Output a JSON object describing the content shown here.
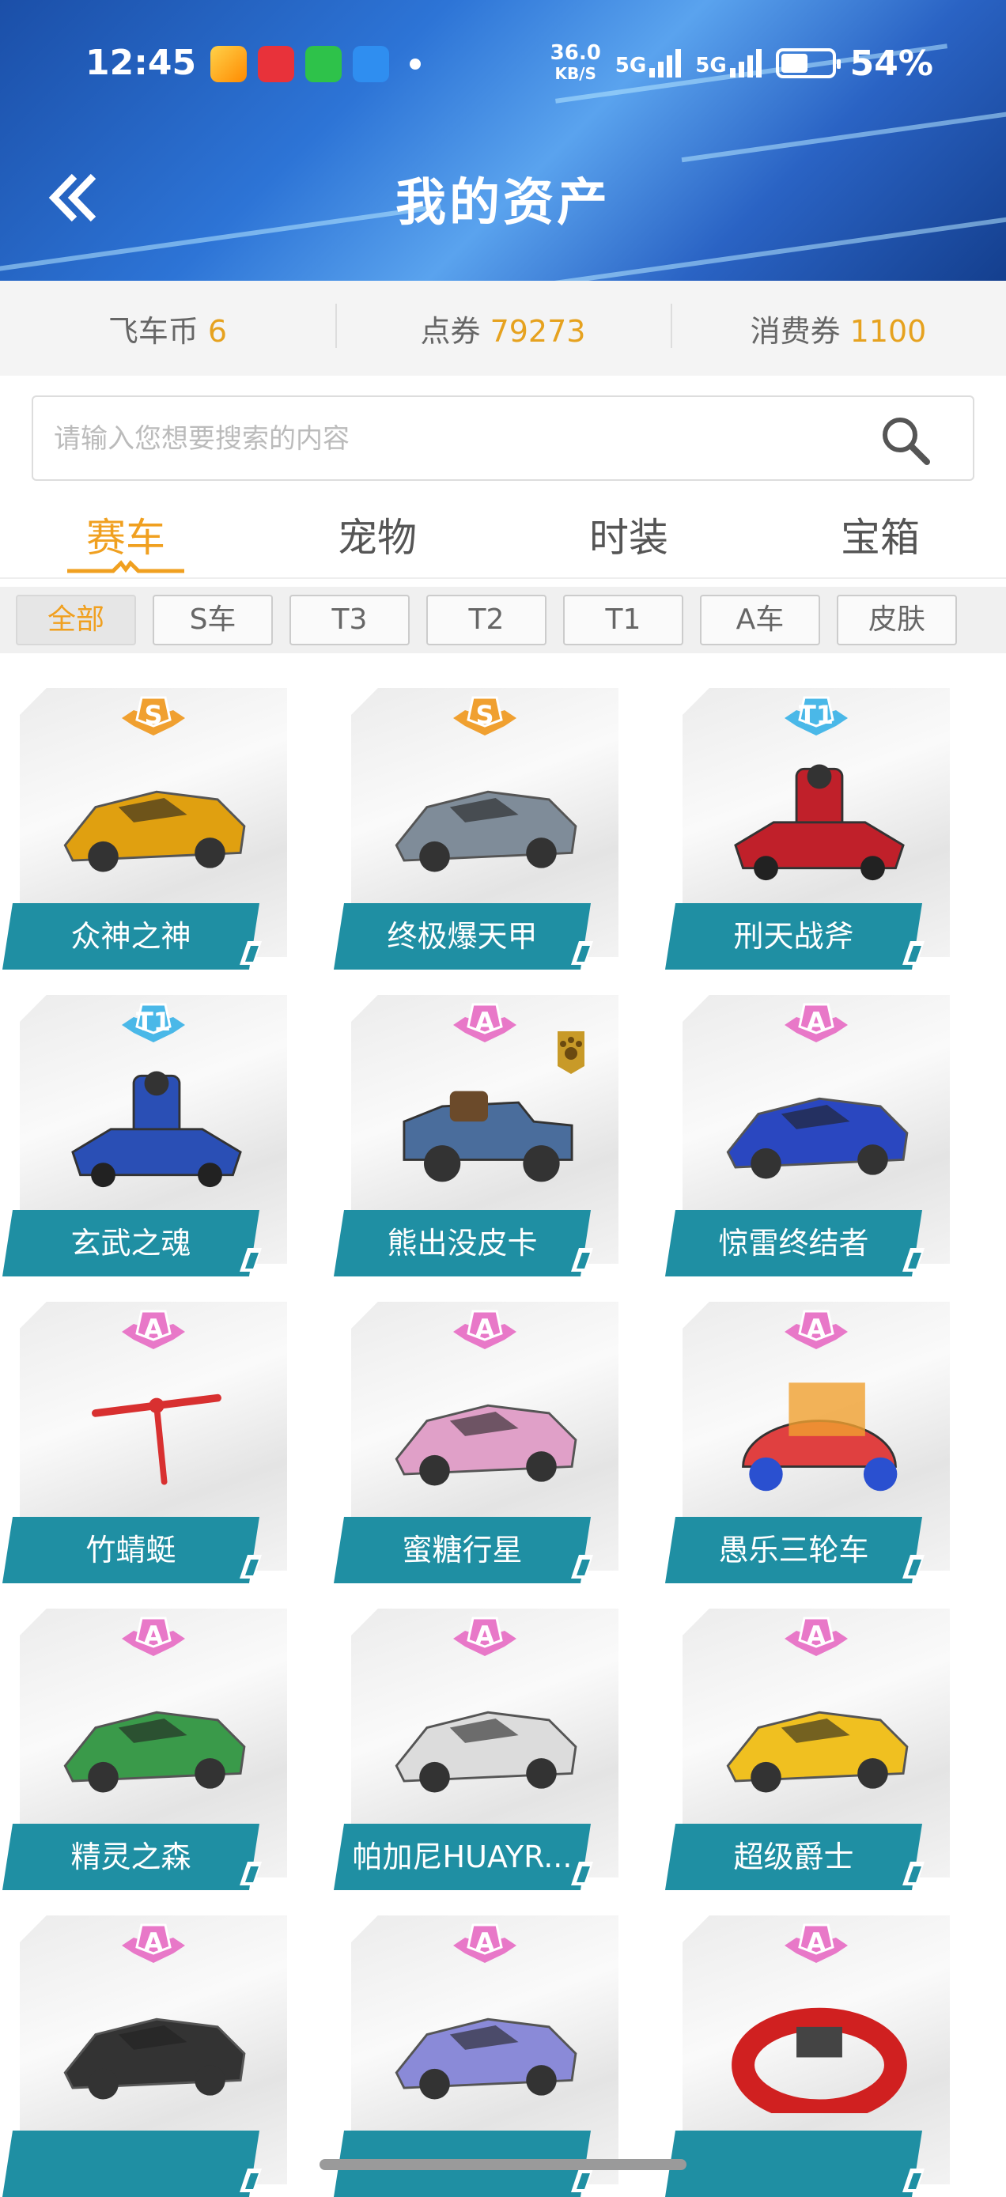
{
  "status_bar": {
    "time": "12:45",
    "net_speed_value": "36.0",
    "net_speed_unit": "KB/S",
    "sim1": "5G",
    "sim2": "5G",
    "battery": "54%",
    "battery_level": 0.54
  },
  "header": {
    "title": "我的资产"
  },
  "currency": [
    {
      "label": "飞车币",
      "value": "6"
    },
    {
      "label": "点券",
      "value": "79273"
    },
    {
      "label": "消费券",
      "value": "1100"
    }
  ],
  "search": {
    "placeholder": "请输入您想要搜索的内容"
  },
  "tabs": [
    {
      "label": "赛车",
      "active": true
    },
    {
      "label": "宠物",
      "active": false
    },
    {
      "label": "时装",
      "active": false
    },
    {
      "label": "宝箱",
      "active": false
    }
  ],
  "filters": [
    {
      "label": "全部",
      "active": true
    },
    {
      "label": "S车",
      "active": false
    },
    {
      "label": "T3",
      "active": false
    },
    {
      "label": "T2",
      "active": false
    },
    {
      "label": "T1",
      "active": false
    },
    {
      "label": "A车",
      "active": false
    },
    {
      "label": "皮肤",
      "active": false
    }
  ],
  "items": [
    {
      "name": "众神之神",
      "grade": "S",
      "color": "#e0a010"
    },
    {
      "name": "终极爆天甲",
      "grade": "S",
      "color": "#7f8c99"
    },
    {
      "name": "刑天战斧",
      "grade": "T1",
      "color": "#c0202a"
    },
    {
      "name": "玄武之魂",
      "grade": "T1",
      "color": "#2a4fb5"
    },
    {
      "name": "熊出没皮卡",
      "grade": "A",
      "color": "#4a6d9c"
    },
    {
      "name": "惊雷终结者",
      "grade": "A",
      "color": "#2a47c0"
    },
    {
      "name": "竹蜻蜓",
      "grade": "A",
      "color": "#d83030"
    },
    {
      "name": "蜜糖行星",
      "grade": "A",
      "color": "#e0a0c8"
    },
    {
      "name": "愚乐三轮车",
      "grade": "A",
      "color": "#e04040"
    },
    {
      "name": "精灵之森",
      "grade": "A",
      "color": "#3a9a4a"
    },
    {
      "name": "帕加尼HUAYR...",
      "grade": "A",
      "color": "#dcdcdc"
    },
    {
      "name": "超级爵士",
      "grade": "A",
      "color": "#f0c020"
    },
    {
      "name": "",
      "grade": "A",
      "color": "#333333"
    },
    {
      "name": "",
      "grade": "A",
      "color": "#8a8ad8"
    },
    {
      "name": "",
      "grade": "A",
      "color": "#d02020"
    }
  ],
  "colors": {
    "accent": "#f0a020",
    "label_bg": "#1f8fa3",
    "grade_S": "#f0a030",
    "grade_T1": "#4ab8e8",
    "grade_A": "#e878c8"
  }
}
